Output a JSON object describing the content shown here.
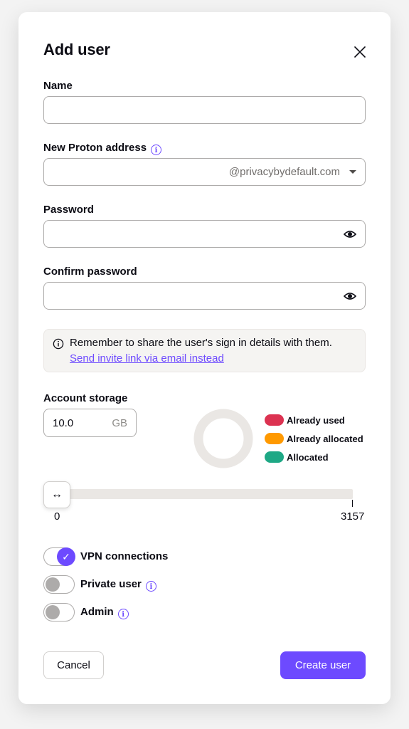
{
  "dialog": {
    "title": "Add user",
    "close_label": "Close"
  },
  "form": {
    "name": {
      "label": "Name",
      "value": ""
    },
    "address": {
      "label": "New Proton address",
      "value": "",
      "domain": "@privacybydefault.com"
    },
    "password": {
      "label": "Password",
      "value": ""
    },
    "confirm_password": {
      "label": "Confirm password",
      "value": ""
    }
  },
  "notice": {
    "text": "Remember to share the user's sign in details with them.",
    "link": "Send invite link via email instead"
  },
  "storage": {
    "label": "Account storage",
    "value": "10.0",
    "unit": "GB",
    "slider_min": "0",
    "slider_max": "3157",
    "slider_value": 0,
    "legend": [
      {
        "label": "Already used",
        "color": "#dc3251"
      },
      {
        "label": "Already allocated",
        "color": "#ff9900"
      },
      {
        "label": "Allocated",
        "color": "#1ea885"
      }
    ]
  },
  "toggles": [
    {
      "label": "VPN connections",
      "on": true,
      "info": false
    },
    {
      "label": "Private user",
      "on": false,
      "info": true
    },
    {
      "label": "Admin",
      "on": false,
      "info": true
    }
  ],
  "actions": {
    "cancel": "Cancel",
    "create": "Create user"
  },
  "colors": {
    "accent": "#6d4aff"
  },
  "icons": [
    "close-icon",
    "info-icon",
    "chevron-down-icon",
    "eye-icon",
    "resize-arrows-icon",
    "checkmark-icon"
  ]
}
